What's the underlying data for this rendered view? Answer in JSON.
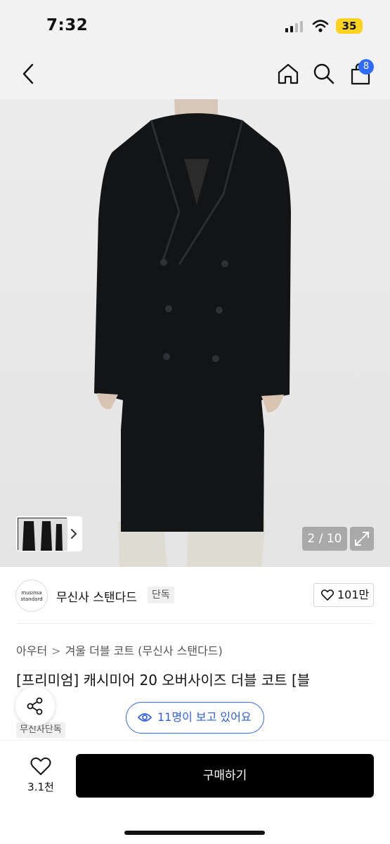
{
  "status_bar": {
    "time": "7:32",
    "battery": "35",
    "battery_color": "#ffd21f",
    "icons": [
      "signal-icon",
      "wifi-icon",
      "battery-icon"
    ]
  },
  "nav": {
    "icons": [
      "back-chevron-icon",
      "home-icon",
      "search-icon",
      "shopping-bag-icon"
    ],
    "cart_badge": "8",
    "badge_color": "#2f6bff"
  },
  "gallery": {
    "counter": "2 / 10",
    "icons": [
      "chevron-right-icon",
      "expand-icon"
    ]
  },
  "brand": {
    "logo_line1": "musinsa",
    "logo_line2": "standard",
    "name": "무신사 스탠다드",
    "tag": "단독",
    "likes": "101만"
  },
  "breadcrumb": [
    "아우터",
    "겨울 더블 코트 (무신사 스탠다드)"
  ],
  "product": {
    "title": "[프리미엄] 캐시미어 20 오버사이즈 더블 코트 [블",
    "exclusive_label": "무신사단독"
  },
  "viewers": {
    "text": "11명이 보고 있어요",
    "accent": "#3a6df0"
  },
  "bottom_bar": {
    "wish_count": "3.1천",
    "buy_label": "구매하기"
  }
}
